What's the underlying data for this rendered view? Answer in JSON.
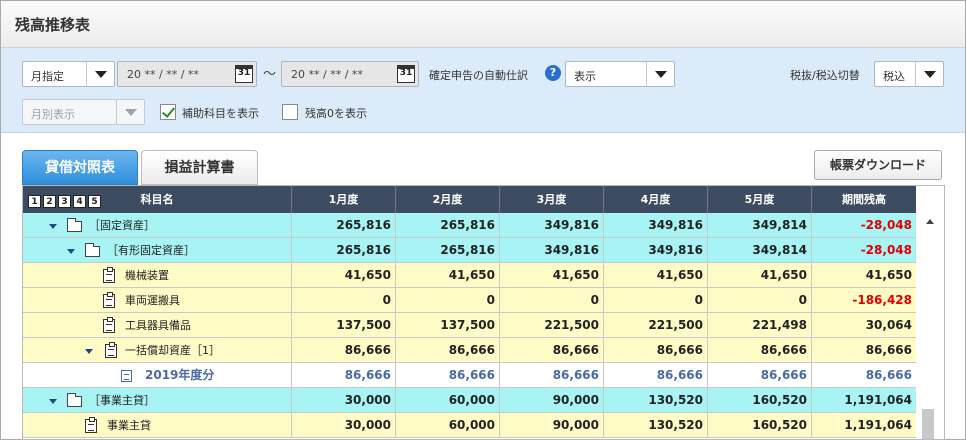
{
  "page": {
    "title": "残高推移表"
  },
  "filters": {
    "period_type": "月指定",
    "date_from": "20 ** / ** / **",
    "date_to": "20 ** / ** / **",
    "tilde": "～",
    "calendar_icon_text": "31",
    "auto_journal_label": "確定申告の自動仕訳",
    "help_text": "?",
    "auto_journal_value": "表示",
    "tax_label": "税抜/税込切替",
    "tax_value": "税込",
    "display_mode": "月別表示",
    "show_sub_accounts_label": "補助科目を表示",
    "show_sub_accounts": true,
    "show_zero_label": "残高0を表示",
    "show_zero": false
  },
  "tabs": [
    {
      "label": "貸借対照表",
      "active": true
    },
    {
      "label": "損益計算書",
      "active": false
    }
  ],
  "download_button": "帳票ダウンロード",
  "table": {
    "levels": [
      "1",
      "2",
      "3",
      "4",
      "5"
    ],
    "headers": [
      "科目名",
      "1月度",
      "2月度",
      "3月度",
      "4月度",
      "5月度",
      "期間残高"
    ],
    "rows": [
      {
        "name": "［固定資産］",
        "type": "group",
        "indent": 0,
        "values": [
          "265,816",
          "265,816",
          "349,816",
          "349,816",
          "349,814",
          "-28,048"
        ]
      },
      {
        "name": "［有形固定資産］",
        "type": "group",
        "indent": 1,
        "values": [
          "265,816",
          "265,816",
          "349,816",
          "349,816",
          "349,814",
          "-28,048"
        ]
      },
      {
        "name": "機械装置",
        "type": "account",
        "indent": 2,
        "values": [
          "41,650",
          "41,650",
          "41,650",
          "41,650",
          "41,650",
          "41,650"
        ]
      },
      {
        "name": "車両運搬具",
        "type": "account",
        "indent": 2,
        "values": [
          "0",
          "0",
          "0",
          "0",
          "0",
          "-186,428"
        ]
      },
      {
        "name": "工具器具備品",
        "type": "account",
        "indent": 2,
        "values": [
          "137,500",
          "137,500",
          "221,500",
          "221,500",
          "221,498",
          "30,064"
        ]
      },
      {
        "name": "一括償却資産［1］",
        "type": "account-expand",
        "indent": 2,
        "values": [
          "86,666",
          "86,666",
          "86,666",
          "86,666",
          "86,666",
          "86,666"
        ]
      },
      {
        "name": "2019年度分",
        "type": "sub",
        "indent": 3,
        "values": [
          "86,666",
          "86,666",
          "86,666",
          "86,666",
          "86,666",
          "86,666"
        ]
      },
      {
        "name": "［事業主貸］",
        "type": "group",
        "indent": 0,
        "values": [
          "30,000",
          "60,000",
          "90,000",
          "130,520",
          "160,520",
          "1,191,064"
        ]
      },
      {
        "name": "事業主貸",
        "type": "account",
        "indent": 1,
        "values": [
          "30,000",
          "60,000",
          "90,000",
          "130,520",
          "160,520",
          "1,191,064"
        ]
      }
    ]
  }
}
